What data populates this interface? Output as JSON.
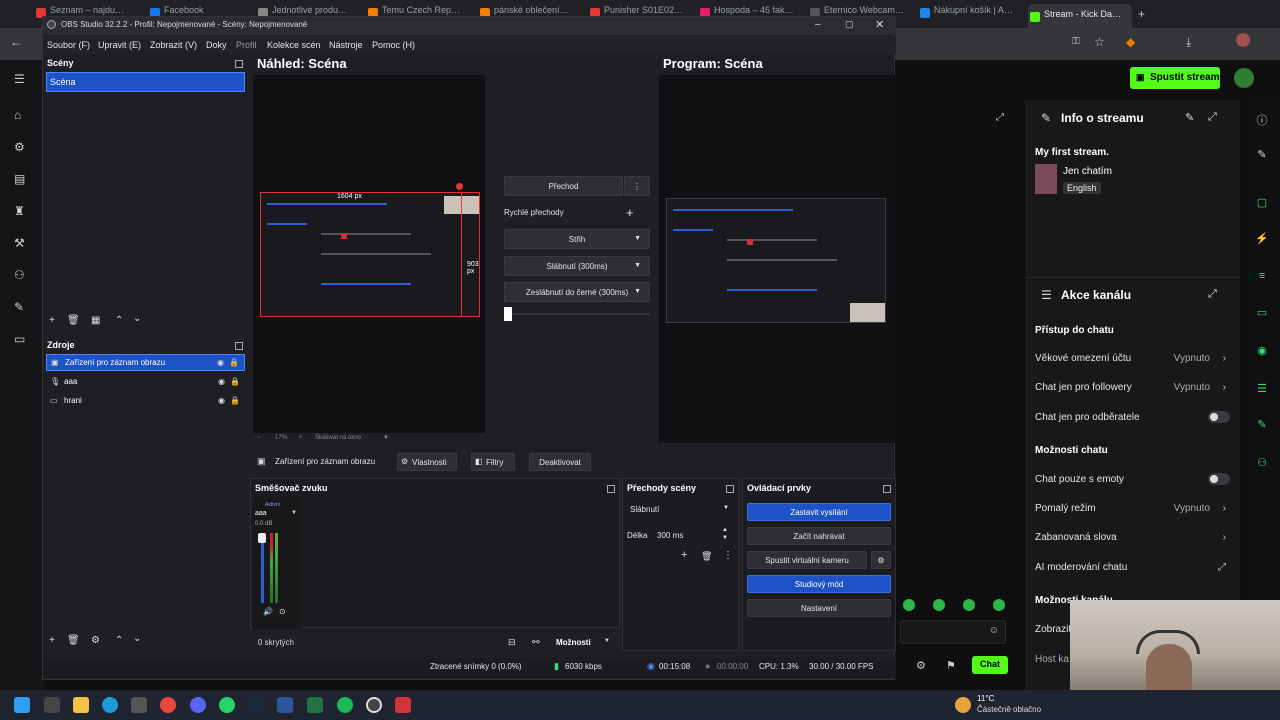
{
  "browser": {
    "tabs": [
      "Seznam – najdu…",
      "Facebook",
      "Jednotlivé produ…",
      "Temu Czech Rep…",
      "pánské oblečení…",
      "Punisher S01E02…",
      "Hospoda – 45 fak…",
      "Eternico Webcam…",
      "Nákupní košík | A…",
      "Stream - Kick Da…"
    ],
    "active_tab_index": 9
  },
  "stream_page": {
    "start_stream_label": "Spustit stream",
    "info_title": "Info o streamu",
    "stream_title": "My first stream.",
    "category": "Jen chatím",
    "language": "English",
    "channel_actions_title": "Akce kanálu",
    "chat_access_title": "Přístup do chatu",
    "rows": [
      {
        "label": "Věkové omezení účtu",
        "value": "Vypnuto",
        "kind": "chevron"
      },
      {
        "label": "Chat jen pro followery",
        "value": "Vypnuto",
        "kind": "chevron"
      },
      {
        "label": "Chat jen pro odběratele",
        "value": "",
        "kind": "toggle"
      }
    ],
    "chat_options_title": "Možnosti chatu",
    "chat_rows": [
      {
        "label": "Chat pouze s emoty",
        "value": "",
        "kind": "toggle"
      },
      {
        "label": "Pomalý režim",
        "value": "Vypnuto",
        "kind": "chevron"
      },
      {
        "label": "Zabanovaná slova",
        "value": "",
        "kind": "chevron"
      },
      {
        "label": "AI moderování chatu",
        "value": "",
        "kind": "link"
      }
    ],
    "channel_options_title": "Možnosti kanálu",
    "cut_rows": [
      "Zobrazit",
      "Host ka"
    ],
    "chat_button": "Chat"
  },
  "obs": {
    "window_title": "OBS Studio 32.2.2 - Profil: Nepojmenované - Scény: Nepojmenované",
    "menu": [
      "Soubor (F)",
      "Upravit (E)",
      "Zobrazit (V)",
      "Doky",
      "Profil",
      "Kolekce scén",
      "Nástroje",
      "Pomoc (H)"
    ],
    "scenes_title": "Scény",
    "scenes": [
      "Scéna"
    ],
    "sources_title": "Zdroje",
    "sources": [
      {
        "name": "Zařízení pro záznam obrazu",
        "icon": "camera-icon",
        "selected": true
      },
      {
        "name": "aaa",
        "icon": "microphone-icon",
        "selected": false
      },
      {
        "name": "hrani",
        "icon": "window-icon",
        "selected": false
      }
    ],
    "preview_title": "Náhled: Scéna",
    "program_title": "Program: Scéna",
    "size_width_label": "1604 px",
    "size_height_label": "903 px",
    "transitions": {
      "transition_button": "Přechod",
      "quick_label": "Rychlé přechody",
      "options": [
        "Střih",
        "Slábnutí (300ms)",
        "Zeslábnutí do černé (300ms)"
      ]
    },
    "zoom_label": "17%",
    "zoom_fit_label": "Škálovat na okno",
    "source_toolbar": {
      "source_name": "Zařízení pro záznam obrazu",
      "properties": "Vlastnosti",
      "filters": "Filtry",
      "deactivate": "Deaktivovat"
    },
    "mixer": {
      "title": "Směšovač zvuku",
      "channel_name": "aaa",
      "channel_state": "Aktivní",
      "db_label": "0.0 dB",
      "hidden_count": "0 skrytých",
      "options_label": "Možnosti"
    },
    "scene_transitions": {
      "title": "Přechody scény",
      "selected": "Slábnutí",
      "duration_label": "Délka",
      "duration_value": "300 ms"
    },
    "controls": {
      "title": "Ovládací prvky",
      "stop_stream": "Zastavit vysílání",
      "start_recording": "Začít nahrávat",
      "virtual_cam": "Spustit virtuální kameru",
      "studio_mode": "Studiový mód",
      "settings": "Nastavení"
    },
    "status": {
      "dropped": "Ztracené snímky 0 (0.0%)",
      "bitrate": "6030 kbps",
      "stream_time": "00:15:08",
      "record_time": "00:00:00",
      "cpu": "CPU: 1.3%",
      "fps": "30.00 / 30.00 FPS"
    }
  },
  "taskbar": {
    "weather_temp": "11°C",
    "weather_text": "Částečně oblačno"
  }
}
